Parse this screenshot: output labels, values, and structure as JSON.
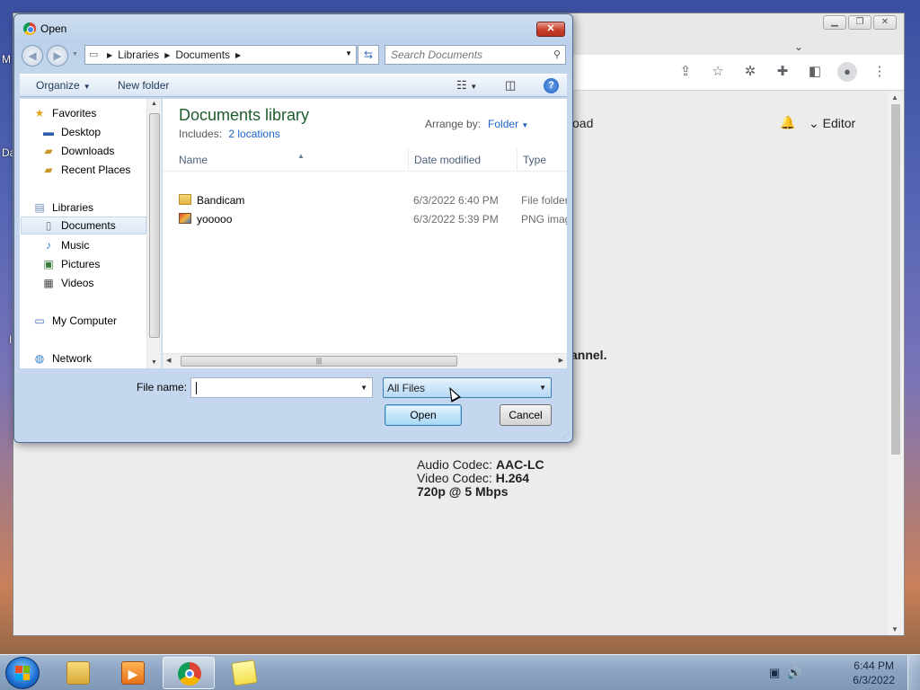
{
  "desktop": {
    "left_edge_labels": [
      "M",
      "Da",
      "I"
    ]
  },
  "browser": {
    "tab_menu": "⌄",
    "page_fragments": {
      "load": "oad",
      "editor": "Editor",
      "channel": "annel.",
      "audio_label": "Audio Codec: ",
      "audio_value": "AAC-LC",
      "video_label": "Video Codec: ",
      "video_value": "H.264",
      "quality": "720p @ 5 Mbps"
    }
  },
  "dialog": {
    "title": "Open",
    "close_label": "✕",
    "breadcrumb": [
      "Libraries",
      "Documents"
    ],
    "search_placeholder": "Search Documents",
    "organize_label": "Organize",
    "new_folder_label": "New folder",
    "help_label": "?",
    "nav": {
      "favorites": {
        "label": "Favorites",
        "items": [
          "Desktop",
          "Downloads",
          "Recent Places"
        ]
      },
      "libraries": {
        "label": "Libraries",
        "items": [
          "Documents",
          "Music",
          "Pictures",
          "Videos"
        ]
      },
      "selected": "Documents",
      "computer": "My Computer",
      "network": "Network"
    },
    "library_title": "Documents library",
    "includes_label": "Includes:",
    "includes_link": "2 locations",
    "arrange_label": "Arrange by:",
    "arrange_value": "Folder",
    "columns": [
      "Name",
      "Date modified",
      "Type"
    ],
    "files": [
      {
        "name": "Bandicam",
        "date": "6/3/2022 6:40 PM",
        "type": "File folder",
        "icon": "folder-icon"
      },
      {
        "name": "yooooo",
        "date": "6/3/2022 5:39 PM",
        "type": "PNG image",
        "icon": "png-icon"
      }
    ],
    "file_name_label": "File name:",
    "file_name_value": "",
    "file_type_value": "All Files",
    "open_label": "Open",
    "cancel_label": "Cancel"
  },
  "taskbar": {
    "time": "6:44 PM",
    "date": "6/3/2022",
    "apps": [
      "explorer-icon",
      "media-player-icon",
      "chrome-icon",
      "sticky-notes-icon"
    ]
  }
}
